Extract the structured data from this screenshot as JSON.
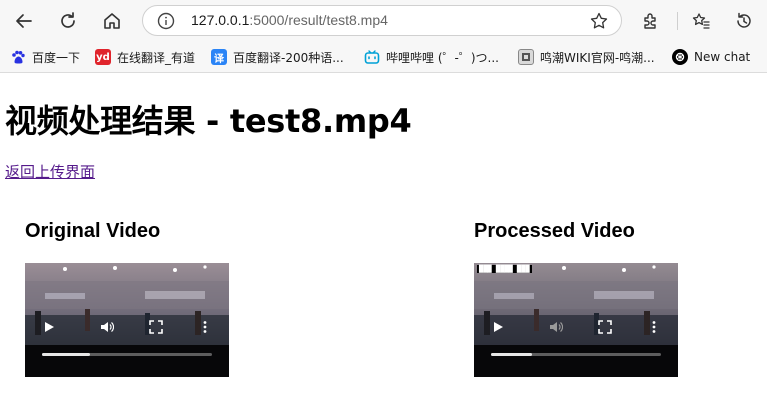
{
  "browser": {
    "url_host": "127.0.0.1",
    "url_rest": ":5000/result/test8.mp4",
    "bookmarks": [
      {
        "label": "百度一下",
        "icon": "baidu-paw-icon",
        "color": "#2932e1"
      },
      {
        "label": "在线翻译_有道",
        "icon": "youdao-icon",
        "color": "#e0242c"
      },
      {
        "label": "百度翻译-200种语...",
        "icon": "baidu-translate-icon",
        "color": "#2a84f6"
      },
      {
        "label": "哔哩哔哩 (゜-゜)つ...",
        "icon": "bilibili-tv-icon",
        "color": "#00a1d6"
      },
      {
        "label": "鸣潮WIKI官网-鸣潮...",
        "icon": "wuwa-wiki-icon",
        "color": "#555555"
      },
      {
        "label": "New chat",
        "icon": "openai-icon",
        "color": "#000000"
      }
    ]
  },
  "page": {
    "title": "视频处理结果 - test8.mp4",
    "back_link": "返回上传界面",
    "videos": [
      {
        "title": "Original Video",
        "progress": 0.28
      },
      {
        "title": "Processed Video",
        "progress": 0.24
      }
    ]
  }
}
